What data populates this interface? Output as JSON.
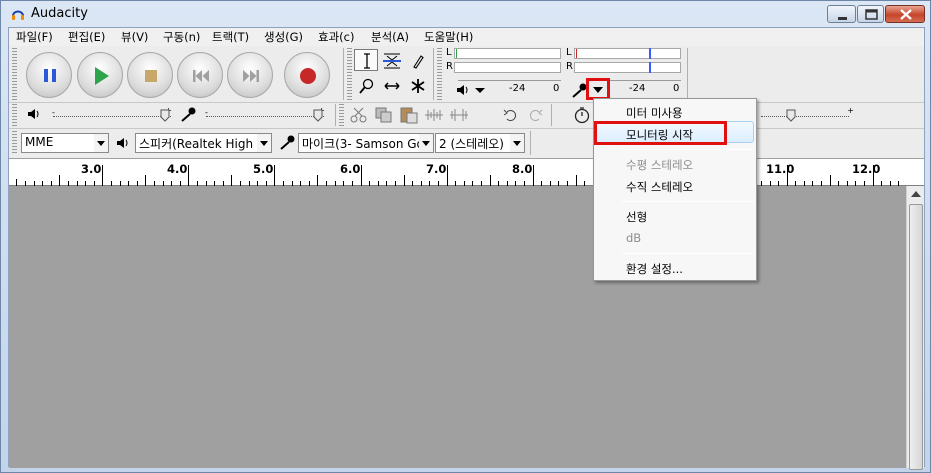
{
  "window": {
    "title": "Audacity"
  },
  "menu": [
    {
      "id": "file",
      "label": "파일(F)"
    },
    {
      "id": "edit",
      "label": "편집(E)"
    },
    {
      "id": "view",
      "label": "뷰(V)"
    },
    {
      "id": "transport",
      "label": "구동(n)"
    },
    {
      "id": "tracks",
      "label": "트랙(T)"
    },
    {
      "id": "generate",
      "label": "생성(G)"
    },
    {
      "id": "effect",
      "label": "효과(c)"
    },
    {
      "id": "analyze",
      "label": "분석(A)"
    },
    {
      "id": "help",
      "label": "도움말(H)"
    }
  ],
  "meters": {
    "play_channels": [
      "L",
      "R"
    ],
    "rec_channels": [
      "L",
      "R"
    ],
    "play_scale": [
      "-24",
      "0"
    ],
    "rec_scale": [
      "-24",
      "0"
    ]
  },
  "device_toolbar": {
    "host": "MME",
    "output_device": "스피커(Realtek High",
    "input_device": "마이크(3- Samson Go",
    "channels": "2 (스테레오)"
  },
  "ruler": {
    "labels": [
      "3.0",
      "4.0",
      "5.0",
      "6.0",
      "7.0",
      "8.0",
      "11.0",
      "12.0"
    ]
  },
  "dropdown_menu": {
    "items": [
      {
        "label": "미터 미사용",
        "enabled": true
      },
      {
        "label": "모니터링 시작",
        "enabled": true,
        "highlighted": true
      },
      {
        "label": "수평 스테레오",
        "enabled": false
      },
      {
        "label": "수직 스테레오",
        "enabled": true
      },
      {
        "label": "선형",
        "enabled": true
      },
      {
        "label": "dB",
        "enabled": false
      },
      {
        "label": "환경 설정...",
        "enabled": true
      }
    ]
  },
  "colors": {
    "play_green": "#2ea44a",
    "pause_blue": "#2a5bd7",
    "record_red": "#c62828",
    "stop_tan": "#c8a86a",
    "highlight_box": "#e01010",
    "meter_marker": "#3a5bff"
  }
}
